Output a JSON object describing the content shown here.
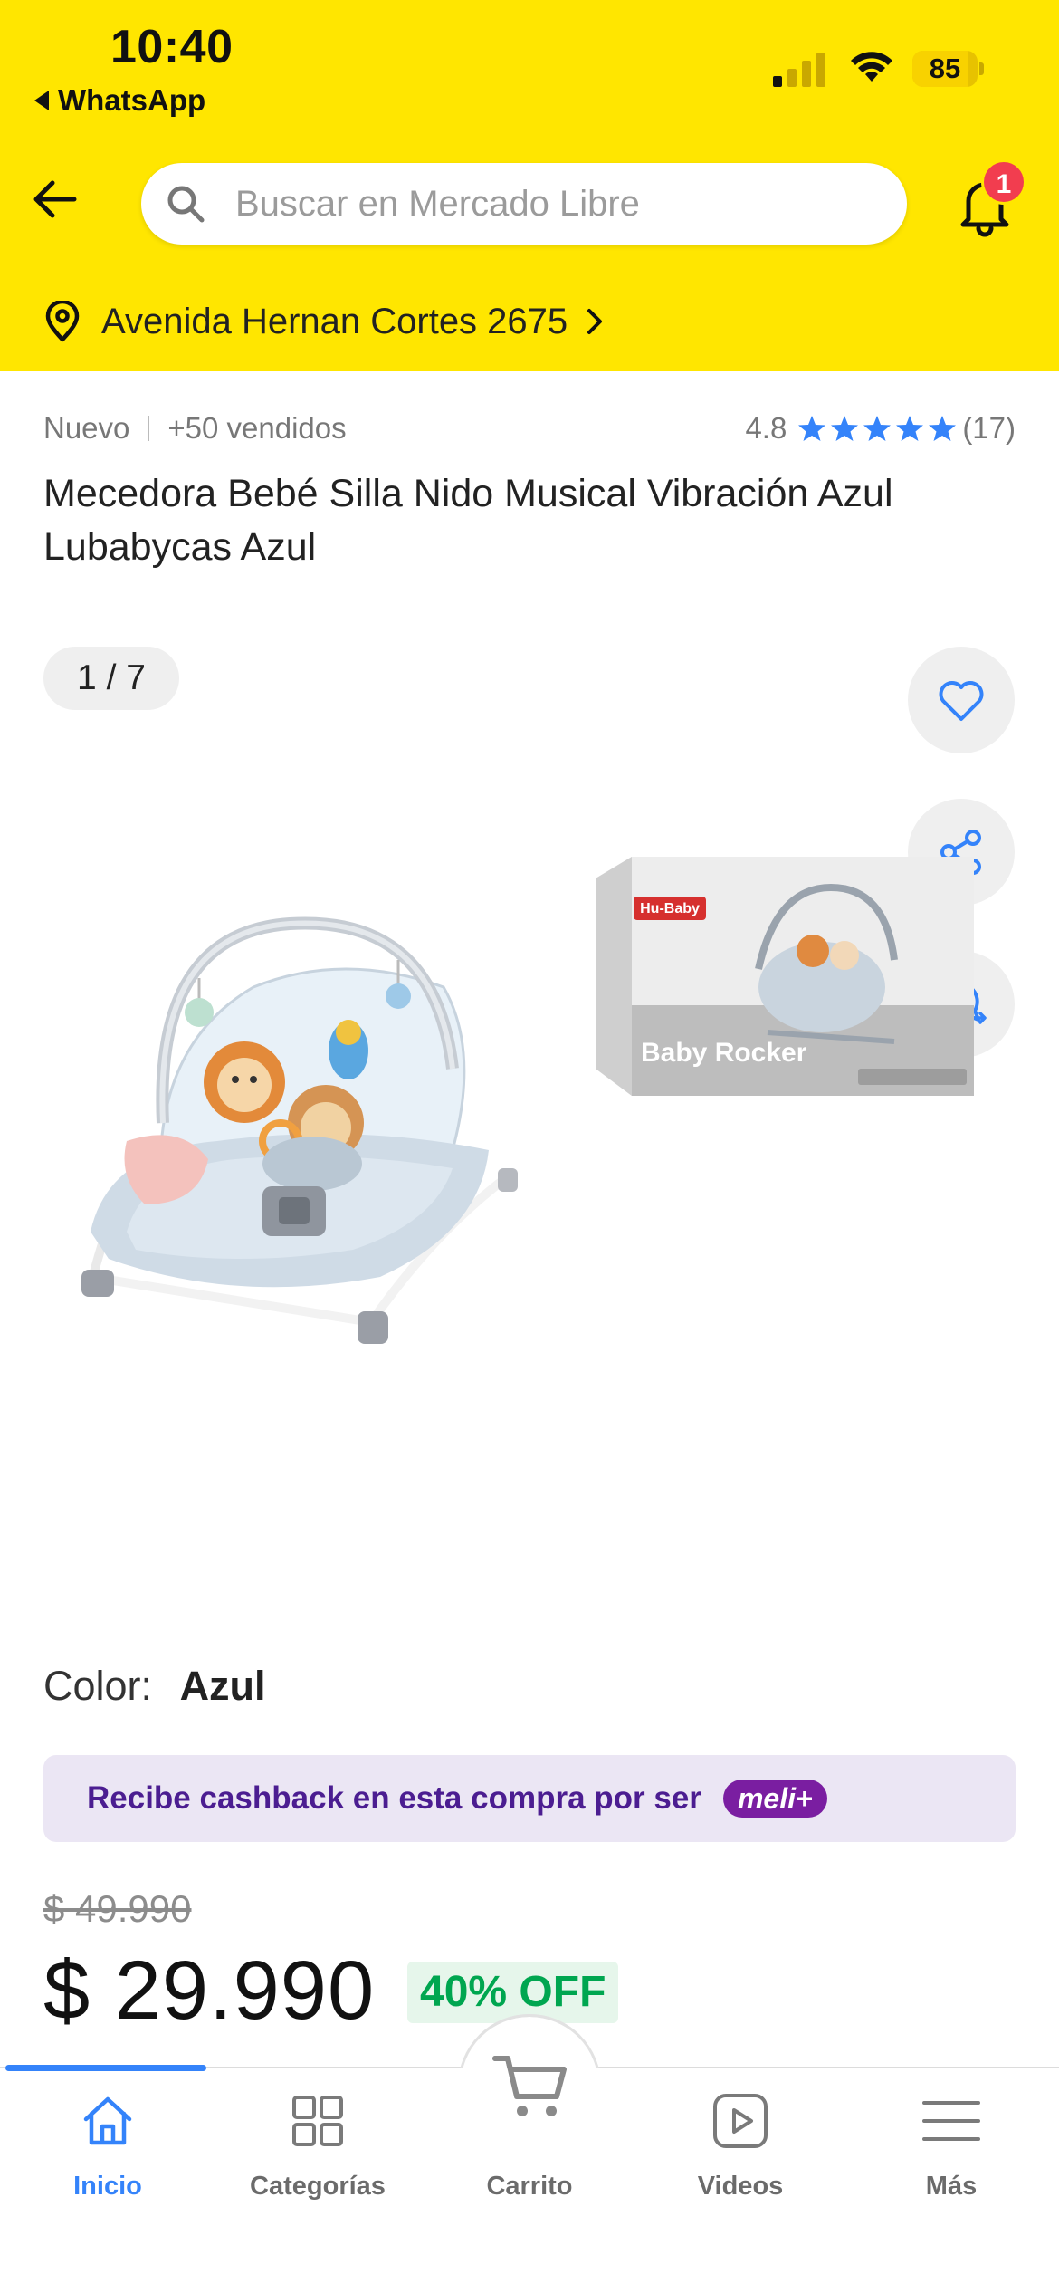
{
  "status_bar": {
    "time": "10:40",
    "back_app": "WhatsApp",
    "battery": "85"
  },
  "header": {
    "search_placeholder": "Buscar en Mercado Libre",
    "notification_count": "1",
    "address": "Avenida Hernan Cortes 2675",
    "background_color": "#ffe600"
  },
  "product": {
    "condition": "Nuevo",
    "sold": "+50 vendidos",
    "rating": "4.8",
    "stars": 5,
    "reviews": "(17)",
    "title": "Mecedora Bebé Silla Nido Musical Vibración Azul Lubabycas Azul",
    "gallery_counter": "1 / 7",
    "box_brand": "Hu-Baby",
    "box_text": "Baby Rocker",
    "color_label": "Color:",
    "color_value": "Azul",
    "cashback_text": "Recibe cashback en esta compra por ser",
    "cashback_badge": "meli+",
    "old_price": "$ 49.990",
    "price": "$ 29.990",
    "discount": "40% OFF"
  },
  "bottom_nav": {
    "items": [
      {
        "label": "Inicio",
        "icon": "home-icon",
        "active": true
      },
      {
        "label": "Categorías",
        "icon": "grid-icon",
        "active": false
      },
      {
        "label": "Carrito",
        "icon": "cart-icon",
        "active": false
      },
      {
        "label": "Videos",
        "icon": "play-icon",
        "active": false
      },
      {
        "label": "Más",
        "icon": "menu-icon",
        "active": false
      }
    ],
    "accent_color": "#3483fa"
  }
}
